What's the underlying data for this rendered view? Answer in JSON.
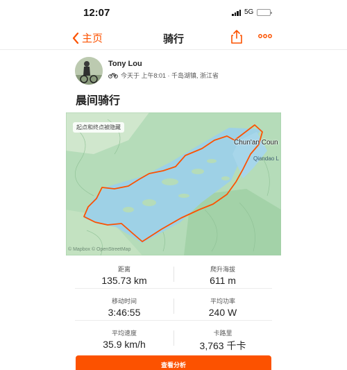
{
  "status_bar": {
    "time": "12:07",
    "network": "5G",
    "battery_level": 0.2
  },
  "nav": {
    "back_label": "主页",
    "title": "骑行",
    "share_icon": "share-icon",
    "more_icon": "more-icon"
  },
  "athlete": {
    "name": "Tony Lou",
    "meta": "今天于 上午8:01 · 千岛湖镇, 浙江省",
    "sport_icon": "bike-icon"
  },
  "activity": {
    "title": "晨间骑行"
  },
  "map": {
    "toggle_label": "起点和终点被隐藏",
    "place_label": "Chun'an Coun",
    "lake_label": "Qiandao L",
    "credit": "© Mapbox © OpenStreetMap",
    "route_color": "#fc5200"
  },
  "stats": [
    [
      {
        "label": "距离",
        "value": "135.73 km"
      },
      {
        "label": "爬升海拔",
        "value": "611 m"
      }
    ],
    [
      {
        "label": "移动时间",
        "value": "3:46:55"
      },
      {
        "label": "平均功率",
        "value": "240 W"
      }
    ],
    [
      {
        "label": "平均速度",
        "value": "35.9 km/h"
      },
      {
        "label": "卡路里",
        "value": "3,763 千卡"
      }
    ]
  ],
  "analysis_button": {
    "label": "查看分析"
  },
  "colors": {
    "accent": "#fc5200"
  }
}
